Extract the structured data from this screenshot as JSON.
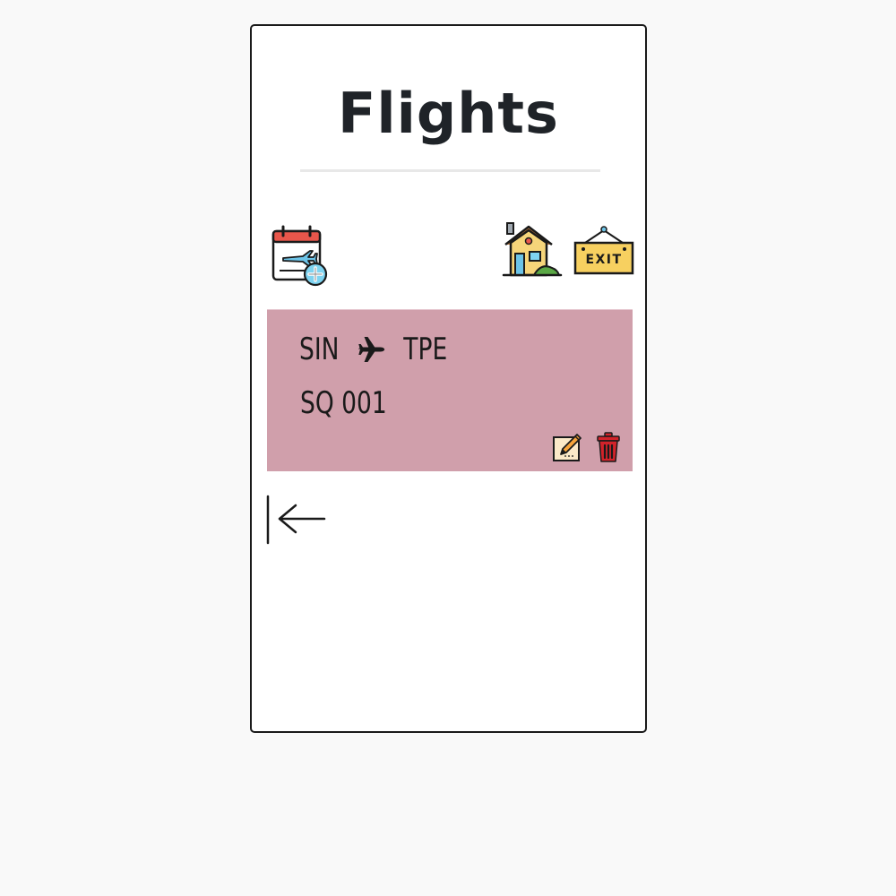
{
  "header": {
    "title": "Flights"
  },
  "toolbar": {
    "add_flight_icon": "calendar-plane-add-icon",
    "home_icon": "house-icon",
    "exit_label": "EXIT"
  },
  "flights": [
    {
      "origin": "SIN",
      "destination": "TPE",
      "flight_number": "SQ 001",
      "card_color": "#d09fab"
    }
  ],
  "navigation": {
    "back_icon": "arrow-left-to-bar-icon"
  },
  "colors": {
    "background": "#f9f9f9",
    "card": "#d09fab",
    "title": "#1f2328",
    "delete_red": "#d2232a",
    "exit_sign": "#f7d060"
  }
}
